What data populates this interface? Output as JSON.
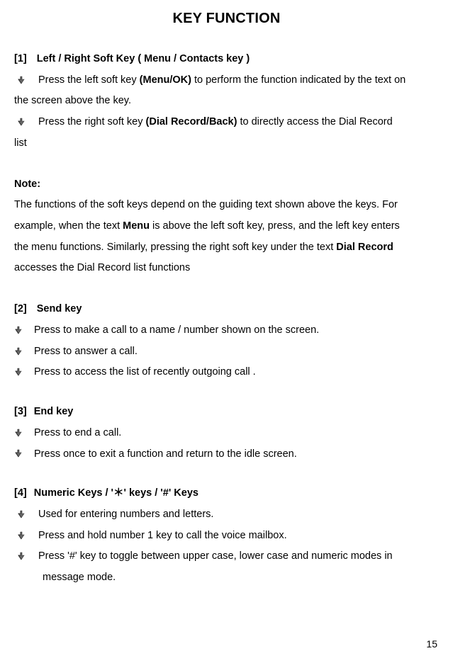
{
  "title": "KEY FUNCTION",
  "page_number": "15",
  "s1": {
    "heading_idx": "[1]",
    "heading": "Left / Right Soft Key ( Menu / Contacts key )",
    "b1a": "Press the left soft key ",
    "b1b_bold": "(Menu/OK)",
    "b1c": " to perform the function indicated by the text on",
    "b1_cont": "the screen above the key.",
    "b2a": "Press the right soft key ",
    "b2b_bold": "(Dial Record/Back)",
    "b2c": " to directly access the Dial Record",
    "b2_cont": "list"
  },
  "note": {
    "label": "Note:",
    "l1a": "The functions of the soft keys depend on the guiding text shown above the keys. For",
    "l2a": "example, when the text ",
    "l2b_bold": "Menu",
    "l2c": " is above the left soft key, press, and the left key enters",
    "l3a": "the menu functions. Similarly, pressing the right soft key under the text ",
    "l3b_bold": "Dial Record",
    "l4": "accesses the Dial Record list functions"
  },
  "s2": {
    "heading_idx": "[2]",
    "heading": "Send key",
    "b1": "Press to make a call to a name / number shown on the screen.",
    "b2": "Press to answer a call.",
    "b3": "Press to access the list of recently outgoing call ."
  },
  "s3": {
    "heading_idx": "[3]",
    "heading": "End key",
    "b1": "Press to end a call.",
    "b2": "Press once to exit a function and return to the idle screen."
  },
  "s4": {
    "heading_idx": "[4]",
    "heading": "Numeric Keys / '＊' keys / '#' Keys",
    "b1": "Used for entering numbers and letters.",
    "b2": "Press and hold number 1 key to call the voice mailbox.",
    "b3": "Press '#' key to toggle between upper case, lower case and numeric modes in",
    "b3_cont": "message mode."
  }
}
